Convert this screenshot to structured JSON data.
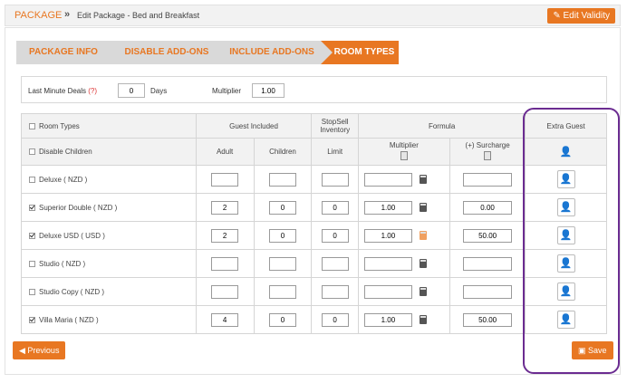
{
  "header": {
    "section": "PACKAGE",
    "separator": "»",
    "title": "Edit Package - Bed and Breakfast",
    "edit_validity": "Edit Validity"
  },
  "steps": [
    "PACKAGE INFO",
    "DISABLE ADD-ONS",
    "INCLUDE ADD-ONS",
    "ROOM TYPES"
  ],
  "deals": {
    "last_minute_label": "Last Minute Deals",
    "help": "(?)",
    "days_value": "0",
    "days_label": "Days",
    "multiplier_label": "Multiplier",
    "multiplier_value": "1.00"
  },
  "table": {
    "col_room_types": "Room Types",
    "col_guest_included": "Guest Included",
    "col_stopsell": "StopSell Inventory",
    "col_formula": "Formula",
    "col_extra_guest": "Extra Guest",
    "disable_children": "Disable Children",
    "adult": "Adult",
    "children": "Children",
    "limit": "Limit",
    "multiplier": "Multiplier",
    "surcharge": "(+) Surcharge",
    "rows": [
      {
        "name": "Deluxe ( NZD )",
        "checked": false,
        "adult": "",
        "children": "",
        "limit": "",
        "multiplier": "",
        "surcharge": ""
      },
      {
        "name": "Superior Double ( NZD )",
        "checked": true,
        "adult": "2",
        "children": "0",
        "limit": "0",
        "multiplier": "1.00",
        "surcharge": "0.00"
      },
      {
        "name": "Deluxe USD ( USD )",
        "checked": true,
        "adult": "2",
        "children": "0",
        "limit": "0",
        "multiplier": "1.00",
        "surcharge": "50.00"
      },
      {
        "name": "Studio ( NZD )",
        "checked": false,
        "adult": "",
        "children": "",
        "limit": "",
        "multiplier": "",
        "surcharge": ""
      },
      {
        "name": "Studio Copy ( NZD )",
        "checked": false,
        "adult": "",
        "children": "",
        "limit": "",
        "multiplier": "",
        "surcharge": ""
      },
      {
        "name": "Villa Maria ( NZD )",
        "checked": true,
        "adult": "4",
        "children": "0",
        "limit": "0",
        "multiplier": "1.00",
        "surcharge": "50.00"
      }
    ]
  },
  "footer": {
    "previous": "Previous",
    "save": "Save"
  },
  "colors": {
    "accent": "#e87722",
    "highlight": "#6b2c91"
  }
}
